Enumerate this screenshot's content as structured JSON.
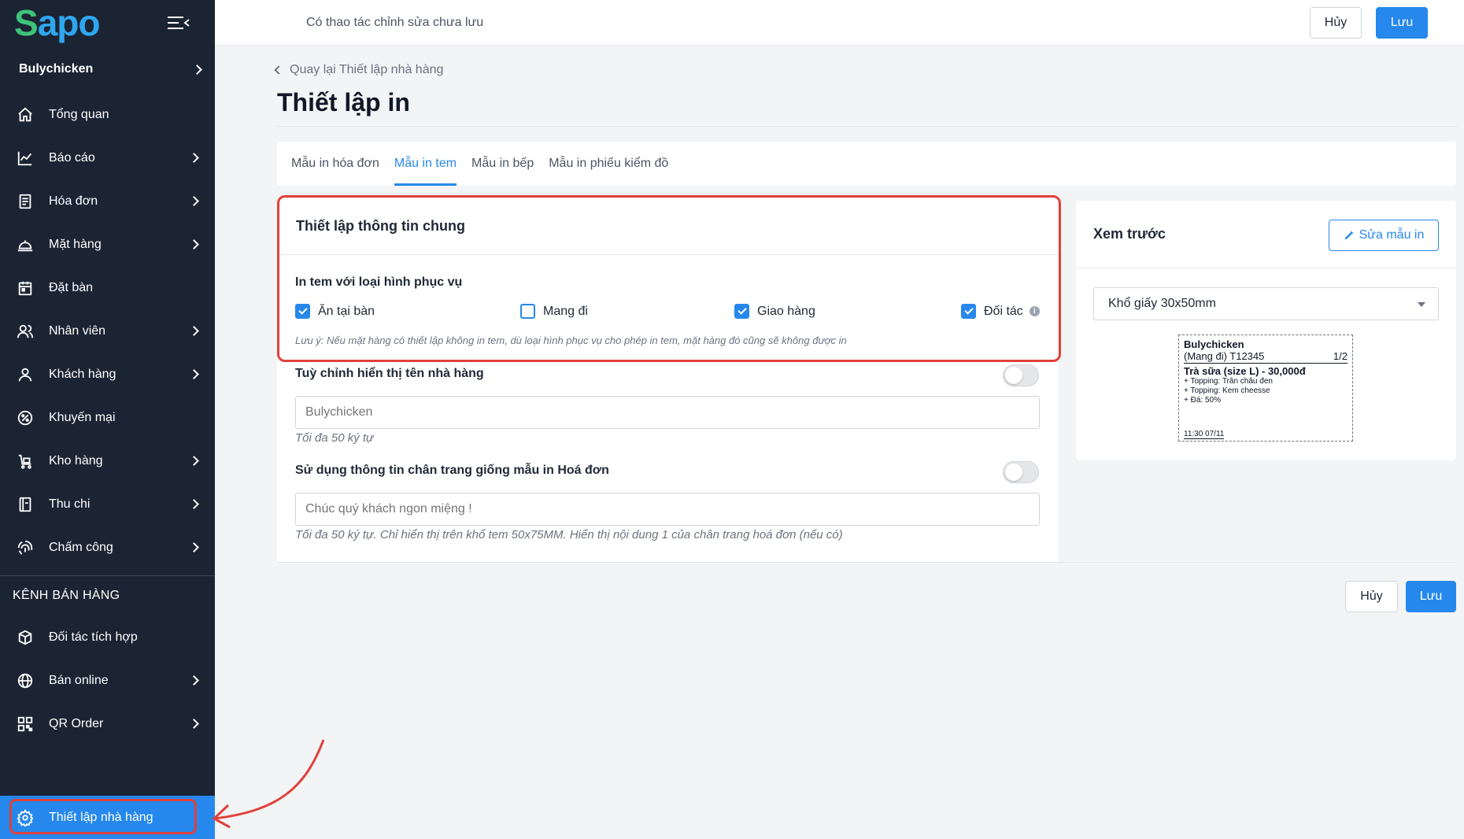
{
  "sidebar": {
    "logo": {
      "s": "S",
      "rest": "apo"
    },
    "store_name": "Bulychicken",
    "items": [
      {
        "label": "Tổng quan",
        "icon": "home-icon",
        "has_arrow": false
      },
      {
        "label": "Báo cáo",
        "icon": "chart-icon",
        "has_arrow": true
      },
      {
        "label": "Hóa đơn",
        "icon": "receipt-icon",
        "has_arrow": true
      },
      {
        "label": "Mặt hàng",
        "icon": "dish-icon",
        "has_arrow": true
      },
      {
        "label": "Đặt bàn",
        "icon": "calendar-icon",
        "has_arrow": false
      },
      {
        "label": "Nhân viên",
        "icon": "users-icon",
        "has_arrow": true
      },
      {
        "label": "Khách hàng",
        "icon": "user-icon",
        "has_arrow": true
      },
      {
        "label": "Khuyến mại",
        "icon": "promo-icon",
        "has_arrow": false
      },
      {
        "label": "Kho hàng",
        "icon": "warehouse-icon",
        "has_arrow": true
      },
      {
        "label": "Thu chi",
        "icon": "cashbook-icon",
        "has_arrow": true
      },
      {
        "label": "Chấm công",
        "icon": "fingerprint-icon",
        "has_arrow": true
      }
    ],
    "section_title": "KÊNH BÁN HÀNG",
    "channel_items": [
      {
        "label": "Đối tác tích hợp",
        "icon": "boxes-icon",
        "has_arrow": false
      },
      {
        "label": "Bán online",
        "icon": "globe-icon",
        "has_arrow": true
      },
      {
        "label": "QR Order",
        "icon": "qr-icon",
        "has_arrow": true
      }
    ],
    "active_item": {
      "label": "Thiết lập nhà hàng",
      "icon": "gear-icon"
    }
  },
  "topbar": {
    "message": "Có thao tác chỉnh sửa chưa lưu",
    "cancel_label": "Hủy",
    "save_label": "Lưu"
  },
  "page": {
    "back_label": "Quay lại Thiết lập nhà hàng",
    "title": "Thiết lập in"
  },
  "tabs": [
    {
      "label": "Mẫu in hóa đơn",
      "active": false
    },
    {
      "label": "Mẫu in tem",
      "active": true
    },
    {
      "label": "Mẫu in bếp",
      "active": false
    },
    {
      "label": "Mẫu in phiếu kiểm đồ",
      "active": false
    }
  ],
  "general": {
    "title": "Thiết lập thông tin chung",
    "service_label": "In tem với loại hình phục vụ",
    "options": [
      {
        "label": "Ăn tại bàn",
        "checked": true
      },
      {
        "label": "Mang đi",
        "checked": false
      },
      {
        "label": "Giao hàng",
        "checked": true
      },
      {
        "label": "Đối tác",
        "checked": true
      }
    ],
    "info_icon": "i",
    "note": "Lưu ý: Nếu mặt hàng có thiết lập không in tem, dù loại hình phục vụ cho phép in tem, mặt hàng đó cũng sẽ không được in",
    "restaurant_name": {
      "label": "Tuỳ chỉnh hiển thị tên nhà hàng",
      "enabled": false,
      "placeholder": "Bulychicken",
      "hint": "Tối đa 50 ký tự"
    },
    "footer": {
      "label": "Sử dụng thông tin chân trang giống mẫu in Hoá đơn",
      "enabled": false,
      "placeholder": "Chúc quý khách ngon miệng !",
      "hint": "Tối đa 50 ký tự. Chỉ hiển thị trên khổ tem 50x75MM. Hiển thị nội dung 1 của chân trang hoá đơn (nếu có)"
    }
  },
  "preview": {
    "title": "Xem trước",
    "edit_label": "Sửa mẫu in",
    "paper_size": "Khổ giấy 30x50mm",
    "label": {
      "store": "Bulychicken",
      "order": "(Mang đi) T12345",
      "page": "1/2",
      "item": "Trà sữa (size L) - 30,000đ",
      "details": [
        "+ Topping: Trân châu đen",
        "+ Topping: Kem cheesse",
        "+ Đá: 50%"
      ],
      "time": "11:30 07/11"
    }
  },
  "footer_actions": {
    "cancel_label": "Hủy",
    "save_label": "Lưu"
  },
  "colors": {
    "sidebar_bg": "#1b2433",
    "primary": "#2688ec",
    "annotation_red": "#e0413a"
  }
}
